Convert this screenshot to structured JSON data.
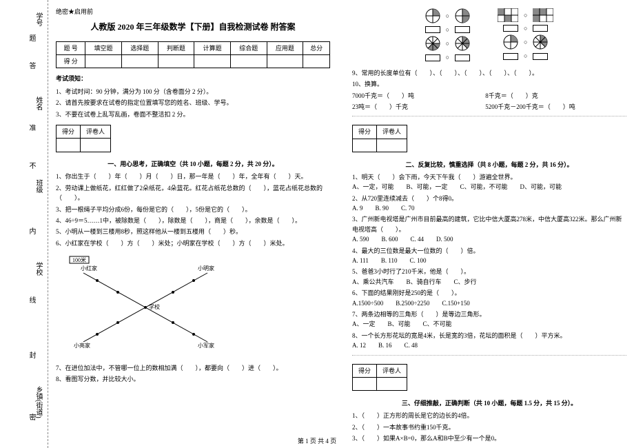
{
  "binding": {
    "labels": [
      "学号",
      "姓名",
      "班级",
      "学校",
      "乡镇(街道)"
    ],
    "marks": [
      "题",
      "答",
      "准",
      "不",
      "内",
      "线",
      "封",
      "密"
    ]
  },
  "secret": "绝密★启用前",
  "title": "人教版 2020 年三年级数学【下册】自我检测试卷 附答案",
  "score_table": {
    "headers": [
      "题 号",
      "填空题",
      "选择题",
      "判断题",
      "计算题",
      "综合题",
      "应用题",
      "总分"
    ],
    "row_label": "得 分"
  },
  "exam_notice_title": "考试须知：",
  "exam_notice": [
    "1、考试时间：90 分钟，满分为 100 分（含卷面分 2 分）。",
    "2、请首先按要求在试卷的指定位置填写您的姓名、班级、学号。",
    "3、不要在试卷上乱写乱画，卷面不整洁扣 2 分。"
  ],
  "mini_table": {
    "c1": "得分",
    "c2": "评卷人"
  },
  "section1_title": "一、用心思考，正确填空（共 10 小题，每题 2 分，共 20 分）。",
  "q1": [
    "1、你出生于（　　）年（　　）月（　　）日，那一年是（　　）年，全年有（　　）天。",
    "2、劳动课上做纸花，红红做了2朵纸花，4朵蓝花。红花占纸花总数的（　　），蓝花占纸花总数的（　　）。",
    "3、把一根绳子平均分成6份，每份是它的（　　），5份是它的（　　）。",
    "4、46÷9＝5……1中，被除数是（　　），除数是（　　），商是（　　），余数是（　　）。",
    "5、小明从一楼到三楼用8秒，照这样他从一楼到五楼用（　　）秒。",
    "6、小红家在学校（　　）方（　　）米处；小明家在学校（　　）方（　　）米处。"
  ],
  "diagram_labels": {
    "top": "100米",
    "ne": "小明家",
    "nw": "小红家",
    "sw": "小亮家",
    "se": "小军家",
    "center": "学校"
  },
  "q1b": [
    "7、在进位加法中，不管哪一位上的数相加满（　　），都要向（　　）进（　　）。",
    "8、看图写分数，并比较大小。"
  ],
  "q9": "9、常用的长度单位有（　　）、（　　）、（　　）、（　　）、（　　）。",
  "q10_title": "10、换算。",
  "q10": [
    "7000千克＝（　　）吨",
    "8千克＝（　　）克",
    "23吨＝（　　）千克",
    "5200千克－200千克＝（　　）吨"
  ],
  "section2_title": "二、反复比较，慎重选择（共 8 小题，每题 2 分，共 16 分）。",
  "q2": [
    {
      "stem": "1、明天（　　）会下雨，今天下午我（　　）游遍全世界。",
      "opts": [
        "A、一定，可能",
        "B、可能，一定",
        "C、可能，不可能",
        "D、可能，可能"
      ]
    },
    {
      "stem": "2、从720里连续减去（　　）个8得0。",
      "opts": [
        "A. 9",
        "B. 90",
        "C. 70"
      ]
    },
    {
      "stem": "3、广州新电视塔是广州市目前最高的建筑，它比中信大厦高278米，中信大厦高322米。那么广州新电视塔高（　　）。",
      "opts": [
        "A. 590",
        "B. 600",
        "C. 44",
        "D. 500"
      ]
    },
    {
      "stem": "4、最大的三位数是最大一位数的（　　）倍。",
      "opts": [
        "A. 111",
        "B. 110",
        "C. 100"
      ]
    },
    {
      "stem": "5、爸爸3小时行了210千米，他是（　　）。",
      "opts": [
        "A、乘公共汽车",
        "B、骑自行车",
        "C、步行"
      ]
    },
    {
      "stem": "6、下面的结果刚好是250的是（　　）。",
      "opts": [
        "A.1500÷500",
        "B.2500÷2250",
        "C.150+150"
      ]
    },
    {
      "stem": "7、两条边相等的三角形（　　）是等边三角形。",
      "opts": [
        "A、一定",
        "B、可能",
        "C、不可能"
      ]
    },
    {
      "stem": "8、一个长方形花坛的宽是4米，长是宽的3倍，花坛的面积是（　　）平方米。",
      "opts": [
        "A. 12",
        "B. 16",
        "C. 48"
      ]
    }
  ],
  "section3_title": "三、仔细推敲，正确判断（共 10 小题，每题 1.5 分，共 15 分）。",
  "q3": [
    "1、（　　）正方形的周长是它的边长的4倍。",
    "2、（　　）一本故事书约重150千克。",
    "3、（　　）如果A×B=0，那么A和B中至少有一个是0。"
  ],
  "footer": "第 1 页 共 4 页"
}
